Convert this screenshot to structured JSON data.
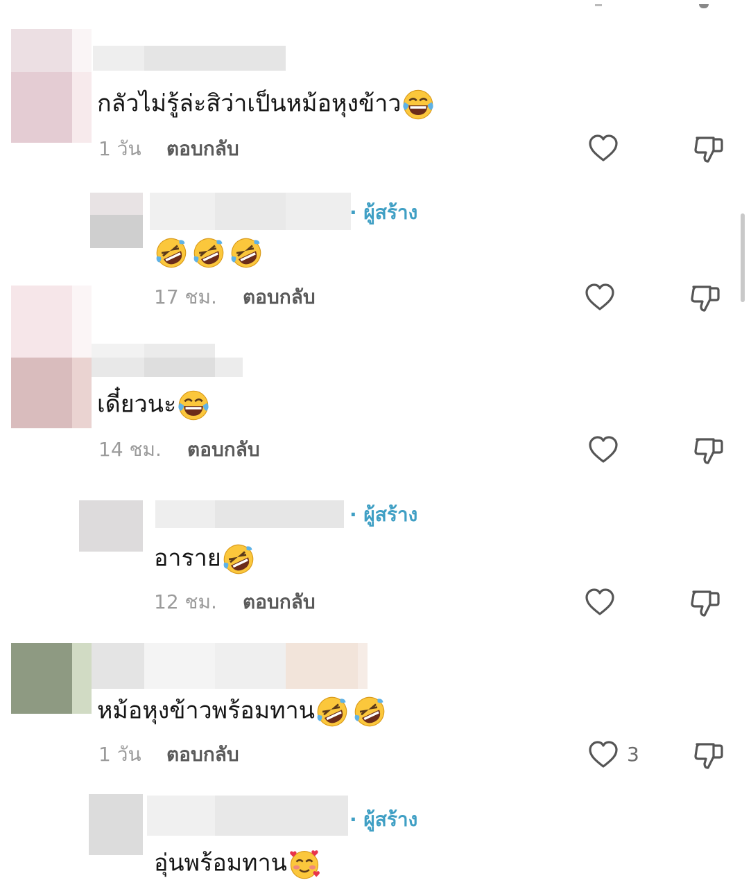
{
  "colors": {
    "creator": "#3f9fc4",
    "time": "#9b9b9b",
    "reply": "#5a5a5a",
    "text": "#161616"
  },
  "icons": {
    "like": "heart-outline-icon",
    "dislike": "thumbs-down-outline-icon"
  },
  "comments": [
    {
      "text": "กลัวไม่รู้ล่ะสิว่าเป็นหม้อหุงข้าว",
      "emojis": [
        "tears-of-joy"
      ],
      "time": "1 วัน",
      "reply_label": "ตอบกลับ",
      "likes": ""
    },
    {
      "creator_label": "· ผู้สร้าง",
      "text": "",
      "emojis": [
        "rofl",
        "rofl",
        "rofl"
      ],
      "time": "17 ชม.",
      "reply_label": "ตอบกลับ",
      "likes": ""
    },
    {
      "text": "เดี๋ยวนะ",
      "emojis": [
        "tears-of-joy"
      ],
      "time": "14 ชม.",
      "reply_label": "ตอบกลับ",
      "likes": ""
    },
    {
      "creator_label": "· ผู้สร้าง",
      "text": "อาราย",
      "emojis": [
        "rofl"
      ],
      "time": "12 ชม.",
      "reply_label": "ตอบกลับ",
      "likes": ""
    },
    {
      "text": "หม้อหุงข้าวพร้อมทาน",
      "emojis": [
        "rofl",
        "rofl"
      ],
      "time": "1 วัน",
      "reply_label": "ตอบกลับ",
      "likes": "3"
    },
    {
      "creator_label": "· ผู้สร้าง",
      "text": "อุ่นพร้อมทาน",
      "emojis": [
        "smiling-face-with-hearts"
      ]
    }
  ]
}
